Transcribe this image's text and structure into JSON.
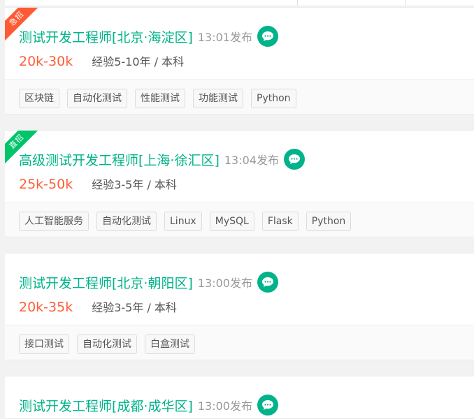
{
  "jobs": [
    {
      "badge": "急招",
      "badge_color": "#ff5a35",
      "title": "测试开发工程师[北京·海淀区]",
      "time": "13:01发布",
      "salary": "20k-30k",
      "requirement": "经验5-10年 / 本科",
      "tags": [
        "区块链",
        "自动化测试",
        "性能测试",
        "功能测试",
        "Python"
      ]
    },
    {
      "badge": "直招",
      "badge_color": "#00c46a",
      "title": "高级测试开发工程师[上海·徐汇区]",
      "time": "13:04发布",
      "salary": "25k-50k",
      "requirement": "经验3-5年 / 本科",
      "tags": [
        "人工智能服务",
        "自动化测试",
        "Linux",
        "MySQL",
        "Flask",
        "Python"
      ]
    },
    {
      "title": "测试开发工程师[北京·朝阳区]",
      "time": "13:00发布",
      "salary": "20k-35k",
      "requirement": "经验3-5年 / 本科",
      "tags": [
        "接口测试",
        "自动化测试",
        "白盒测试"
      ]
    },
    {
      "title": "测试开发工程师[成都·成华区]",
      "time": "13:00发布"
    }
  ],
  "colors": {
    "title": "#00b38a",
    "salary": "#fd5f39",
    "chat_icon": "#00b38a"
  },
  "icons": {
    "chat": "chat-bubble-icon"
  }
}
